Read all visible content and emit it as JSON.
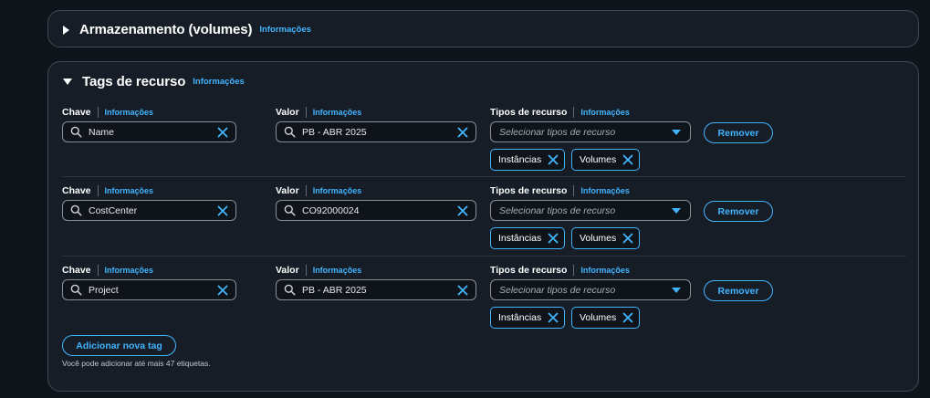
{
  "storage_panel": {
    "title": "Armazenamento (volumes)",
    "info": "Informações"
  },
  "tags_panel": {
    "title": "Tags de recurso",
    "info": "Informações",
    "labels": {
      "key": "Chave",
      "value": "Valor",
      "resource_types": "Tipos de recurso",
      "info": "Informações"
    },
    "resource_placeholder": "Selecionar tipos de recurso",
    "remove_label": "Remover",
    "rows": [
      {
        "key": "Name",
        "value": "PB - ABR 2025",
        "tokens": [
          "Instâncias",
          "Volumes"
        ]
      },
      {
        "key": "CostCenter",
        "value": "CO92000024",
        "tokens": [
          "Instâncias",
          "Volumes"
        ]
      },
      {
        "key": "Project",
        "value": "PB - ABR 2025",
        "tokens": [
          "Instâncias",
          "Volumes"
        ]
      }
    ],
    "add_button": "Adicionar nova tag",
    "helper": "Você pode adicionar até mais 47 etiquetas."
  },
  "colors": {
    "background": "#0f141a",
    "panel": "#161d26",
    "accent": "#42b4ff",
    "border": "#414b57"
  },
  "icons": [
    "caret-right-icon",
    "caret-down-icon",
    "search-icon",
    "clear-icon",
    "dropdown-icon",
    "token-remove-icon"
  ]
}
